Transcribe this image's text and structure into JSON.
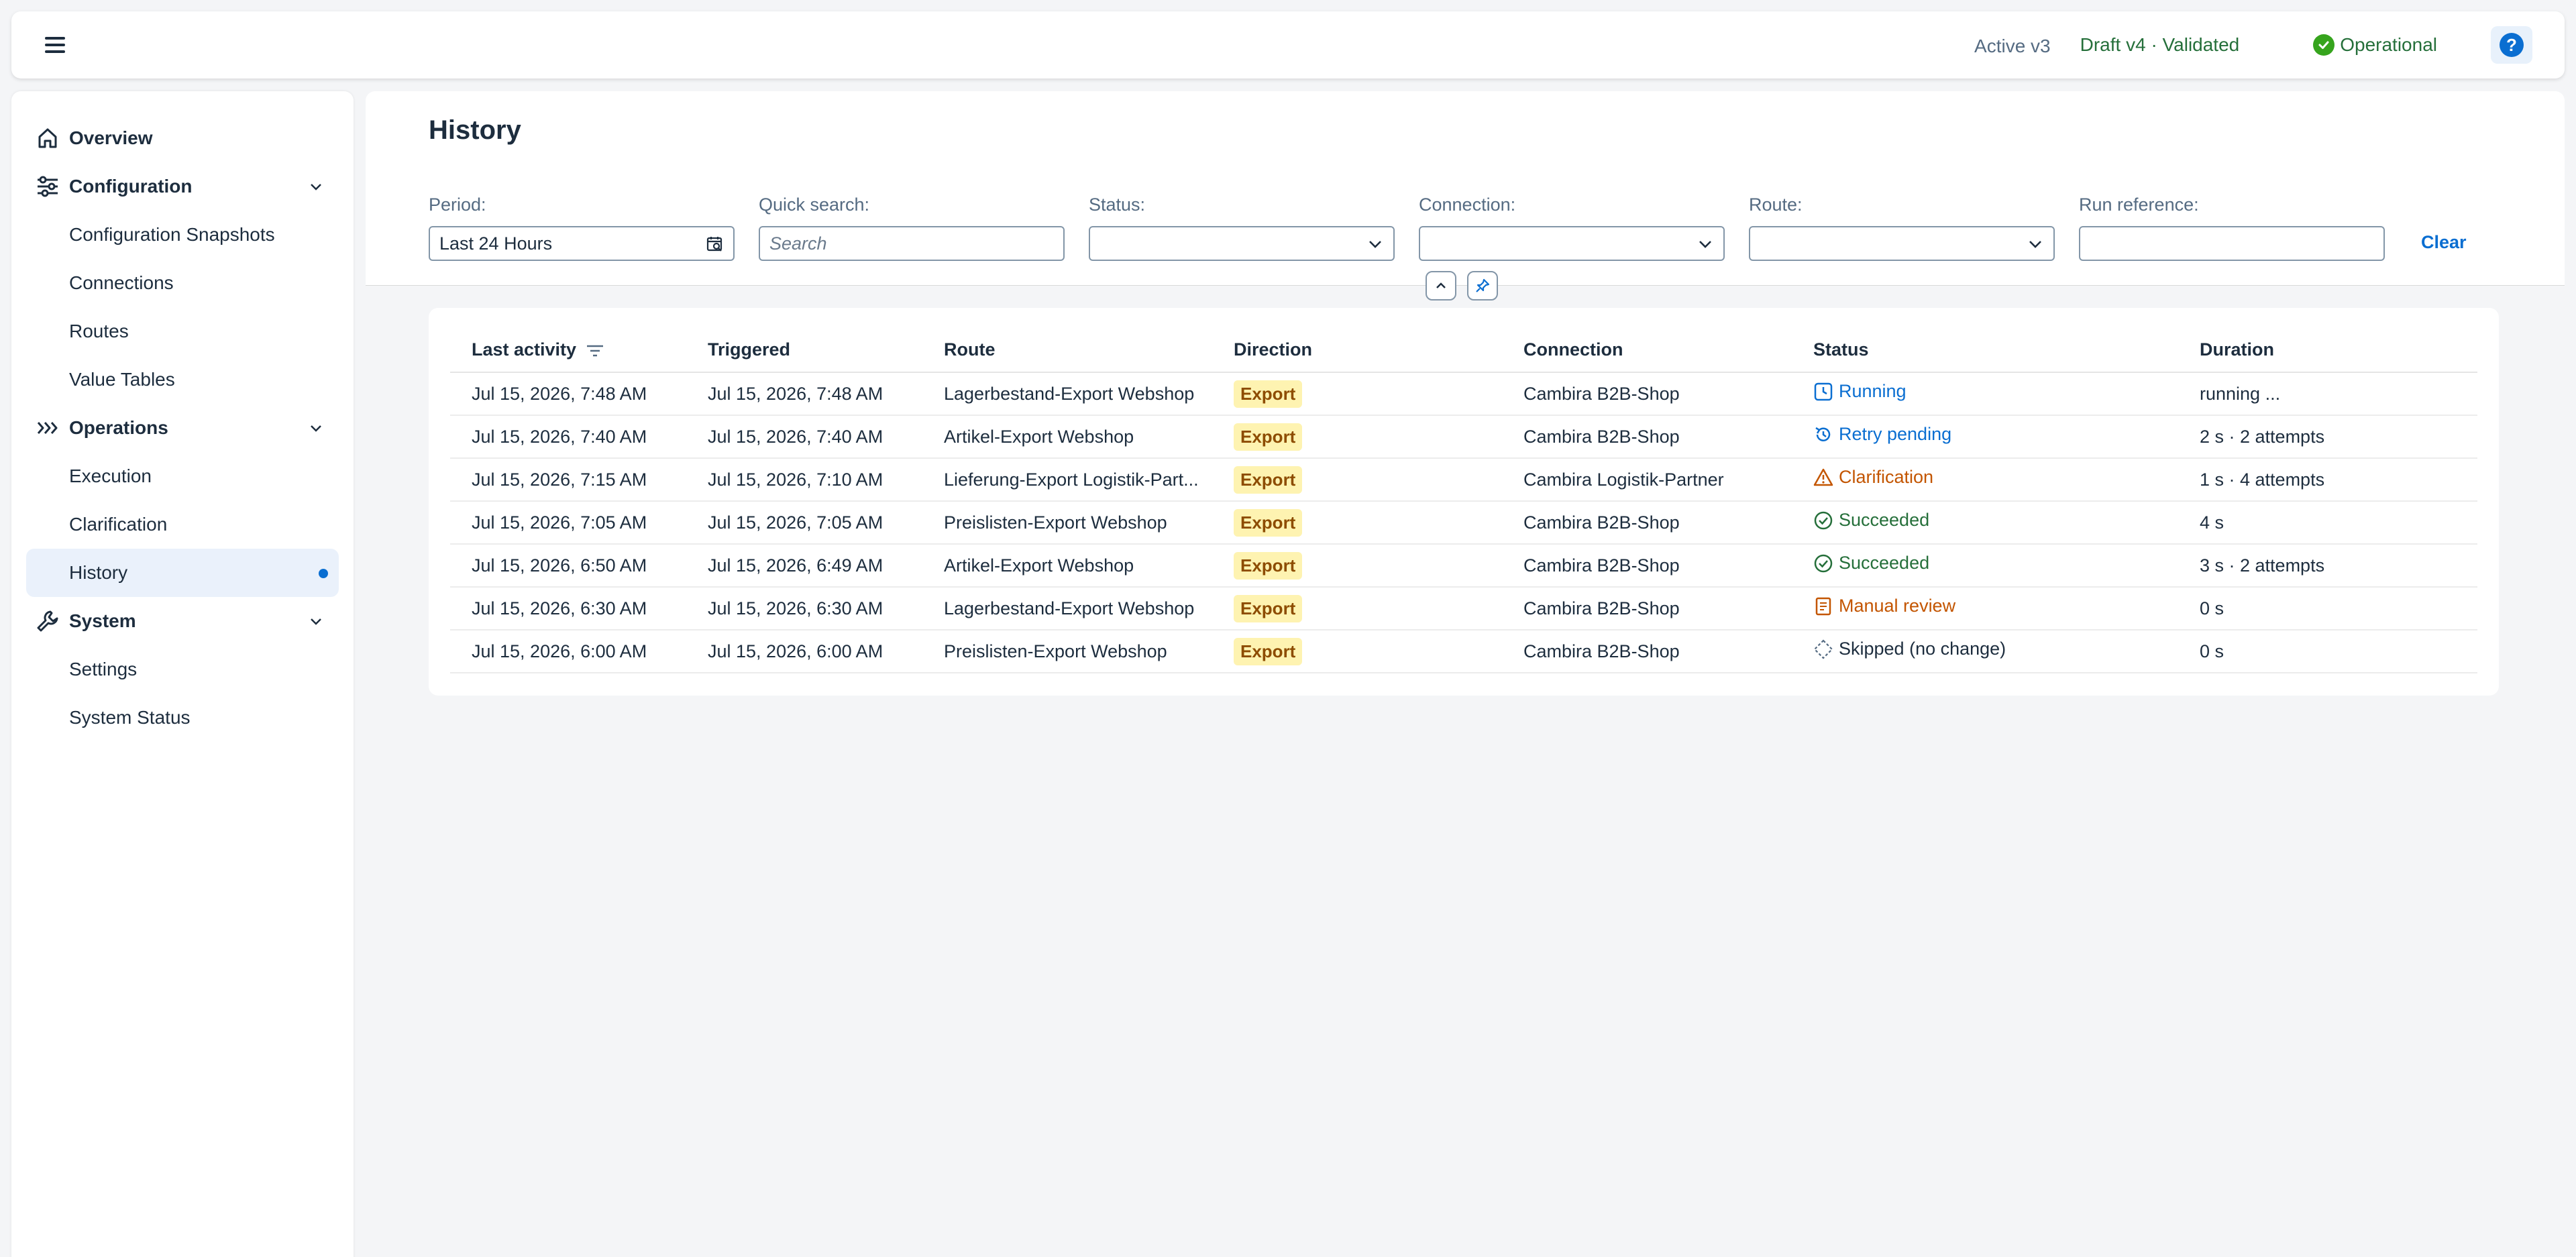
{
  "header": {
    "active_version": "Active v3",
    "draft_version": "Draft v4 · Validated",
    "system_status": "Operational",
    "help_icon": "help-icon",
    "menu_icon": "hamburger-icon",
    "status_color": "#256f3a",
    "accent_color": "#0a6ed1"
  },
  "sidebar": {
    "overview": "Overview",
    "configuration": "Configuration",
    "configuration_items": [
      "Configuration Snapshots",
      "Connections",
      "Routes",
      "Value Tables"
    ],
    "operations": "Operations",
    "operations_items": [
      "Execution",
      "Clarification",
      "History"
    ],
    "system": "System",
    "system_items": [
      "Settings",
      "System Status"
    ],
    "selected": "History"
  },
  "page": {
    "title": "History",
    "filters": {
      "period_label": "Period:",
      "period_value": "Last 24 Hours",
      "search_label": "Quick search:",
      "search_placeholder": "Search",
      "status_label": "Status:",
      "connection_label": "Connection:",
      "route_label": "Route:",
      "run_ref_label": "Run reference:",
      "clear": "Clear"
    }
  },
  "table": {
    "columns": [
      "Last activity",
      "Triggered",
      "Route",
      "Direction",
      "Connection",
      "Status",
      "Duration"
    ],
    "rows": [
      {
        "last": "Jul 15, 2026, 7:48 AM",
        "triggered": "Jul 15, 2026, 7:48 AM",
        "route": "Lagerbestand-Export Webshop",
        "direction": "Export",
        "connection": "Cambira B2B-Shop",
        "status": "Running",
        "status_kind": "running",
        "duration": "running ..."
      },
      {
        "last": "Jul 15, 2026, 7:40 AM",
        "triggered": "Jul 15, 2026, 7:40 AM",
        "route": "Artikel-Export Webshop",
        "direction": "Export",
        "connection": "Cambira B2B-Shop",
        "status": "Retry pending",
        "status_kind": "retry",
        "duration": "2 s · 2 attempts"
      },
      {
        "last": "Jul 15, 2026, 7:15 AM",
        "triggered": "Jul 15, 2026, 7:10 AM",
        "route": "Lieferung-Export Logistik-Part...",
        "direction": "Export",
        "connection": "Cambira Logistik-Partner",
        "status": "Clarification",
        "status_kind": "clar",
        "duration": "1 s · 4 attempts"
      },
      {
        "last": "Jul 15, 2026, 7:05 AM",
        "triggered": "Jul 15, 2026, 7:05 AM",
        "route": "Preislisten-Export Webshop",
        "direction": "Export",
        "connection": "Cambira B2B-Shop",
        "status": "Succeeded",
        "status_kind": "ok",
        "duration": "4 s"
      },
      {
        "last": "Jul 15, 2026, 6:50 AM",
        "triggered": "Jul 15, 2026, 6:49 AM",
        "route": "Artikel-Export Webshop",
        "direction": "Export",
        "connection": "Cambira B2B-Shop",
        "status": "Succeeded",
        "status_kind": "ok",
        "duration": "3 s · 2 attempts"
      },
      {
        "last": "Jul 15, 2026, 6:30 AM",
        "triggered": "Jul 15, 2026, 6:30 AM",
        "route": "Lagerbestand-Export Webshop",
        "direction": "Export",
        "connection": "Cambira B2B-Shop",
        "status": "Manual review",
        "status_kind": "manual",
        "duration": "0 s"
      },
      {
        "last": "Jul 15, 2026, 6:00 AM",
        "triggered": "Jul 15, 2026, 6:00 AM",
        "route": "Preislisten-Export Webshop",
        "direction": "Export",
        "connection": "Cambira B2B-Shop",
        "status": "Skipped (no change)",
        "status_kind": "skip",
        "duration": "0 s"
      }
    ]
  }
}
